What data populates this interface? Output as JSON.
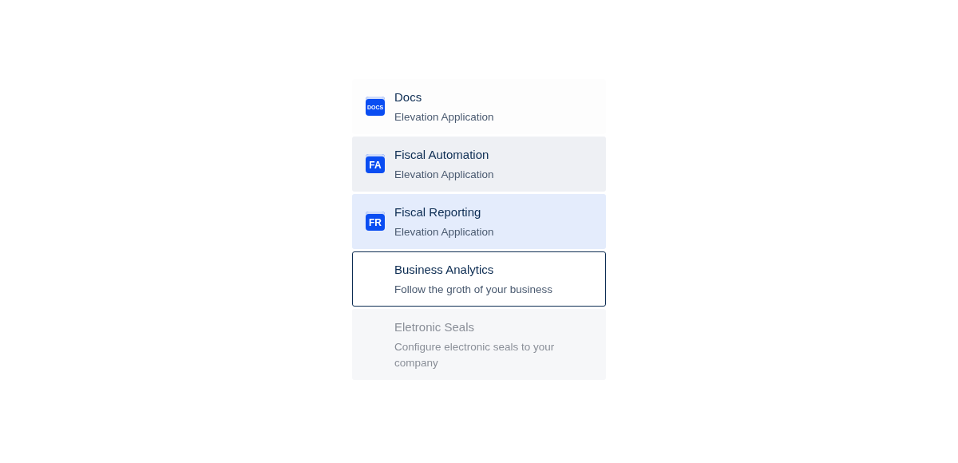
{
  "items": [
    {
      "title": "Docs",
      "subtitle": "Elevation Application",
      "icon_label": "DOCS",
      "selected": false,
      "hovered": false,
      "focused": false,
      "disabled": false
    },
    {
      "title": "Fiscal Automation",
      "subtitle": "Elevation Application",
      "icon_label": "FA",
      "selected": false,
      "hovered": true,
      "focused": false,
      "disabled": false
    },
    {
      "title": "Fiscal Reporting",
      "subtitle": "Elevation Application",
      "icon_label": "FR",
      "selected": true,
      "hovered": false,
      "focused": false,
      "disabled": false
    },
    {
      "title": "Business Analytics",
      "subtitle": "Follow the groth of your business",
      "selected": false,
      "hovered": false,
      "focused": true,
      "disabled": false
    },
    {
      "title": "Eletronic Seals",
      "subtitle": "Configure electronic seals to your company",
      "selected": false,
      "hovered": false,
      "focused": false,
      "disabled": true
    }
  ]
}
